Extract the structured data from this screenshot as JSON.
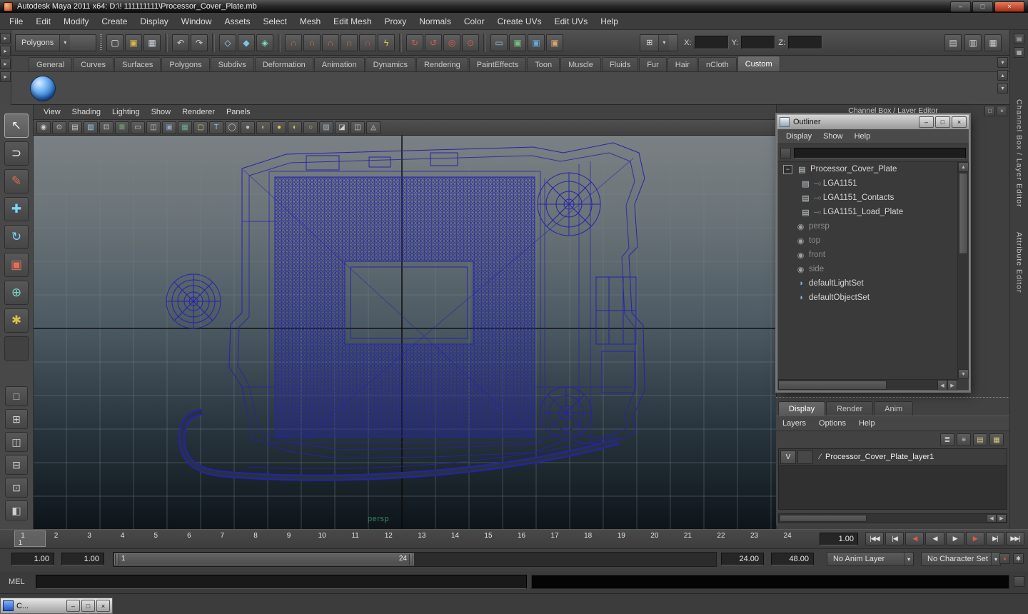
{
  "titlebar": {
    "title": "Autodesk Maya 2011 x64: D:\\! 111111111\\Processor_Cover_Plate.mb",
    "controls": [
      {
        "n": "minimize",
        "g": "–"
      },
      {
        "n": "maximize",
        "g": "□"
      },
      {
        "n": "close",
        "g": "×"
      }
    ]
  },
  "menubar": {
    "items": [
      "File",
      "Edit",
      "Modify",
      "Create",
      "Display",
      "Window",
      "Assets",
      "Select",
      "Mesh",
      "Edit Mesh",
      "Proxy",
      "Normals",
      "Color",
      "Create UVs",
      "Edit UVs",
      "Help"
    ]
  },
  "statusline": {
    "mode_selector": "Polygons",
    "x_label": "X:",
    "y_label": "Y:",
    "z_label": "Z:",
    "left_toggles": [
      {
        "n": "collapse-toolbar-row-1",
        "g": "▸"
      },
      {
        "n": "collapse-toolbar-row-2",
        "g": "▸"
      },
      {
        "n": "collapse-toolbar-row-3",
        "g": "▸"
      },
      {
        "n": "collapse-toolbar-row-4",
        "g": "▸"
      }
    ],
    "icons": [
      {
        "n": "new-scene",
        "g": "▢",
        "c": "#e4e4e4"
      },
      {
        "n": "open-scene",
        "g": "▣",
        "c": "#d9b649"
      },
      {
        "n": "save-scene",
        "g": "▦",
        "c": "#ccd4dc"
      },
      {
        "sep": true
      },
      {
        "n": "undo",
        "g": "↶",
        "c": "#cfcfcf"
      },
      {
        "n": "redo",
        "g": "↷",
        "c": "#cfcfcf"
      },
      {
        "sep": true
      },
      {
        "n": "select-by-hierarchy",
        "g": "◇",
        "c": "#9fd4ef"
      },
      {
        "n": "select-by-object-type",
        "g": "◆",
        "c": "#7cc5e8"
      },
      {
        "n": "select-by-component-type",
        "g": "◈",
        "c": "#7de0c2"
      },
      {
        "sep": true
      },
      {
        "n": "snap-to-grids",
        "g": "∩",
        "c": "#e0614d"
      },
      {
        "n": "snap-to-curves",
        "g": "∩",
        "c": "#d8744a"
      },
      {
        "n": "snap-to-points",
        "g": "∩",
        "c": "#e0614d"
      },
      {
        "n": "snap-to-view-planes",
        "g": "∩",
        "c": "#d8744a"
      },
      {
        "n": "snap-to-surfaces",
        "g": "∩",
        "c": "#c85a46"
      },
      {
        "n": "make-object-live",
        "g": "ϟ",
        "c": "#dcc84e"
      },
      {
        "sep": true
      },
      {
        "n": "inputs-to-selected-object",
        "g": "↻",
        "c": "#d85c4c"
      },
      {
        "n": "outputs-from-selected-object",
        "g": "↺",
        "c": "#d85c4c"
      },
      {
        "n": "construction-history-toggle",
        "g": "◎",
        "c": "#d85c4c"
      },
      {
        "n": "selection-highlighting",
        "g": "⊙",
        "c": "#d85c4c"
      },
      {
        "sep": true
      },
      {
        "n": "open-render-view",
        "g": "▭",
        "c": "#93bcd8"
      },
      {
        "n": "render-current-frame",
        "g": "▣",
        "c": "#74bd85"
      },
      {
        "n": "ipr-render",
        "g": "▣",
        "c": "#63a8d8"
      },
      {
        "n": "render-settings",
        "g": "▣",
        "c": "#d8a468"
      }
    ],
    "right_icons": [
      {
        "n": "show-channel-box",
        "g": "▤",
        "c": "#cfcfcf"
      },
      {
        "n": "show-layer-editor",
        "g": "▥",
        "c": "#cfcfcf"
      },
      {
        "n": "show-attribute-editor",
        "g": "▦",
        "c": "#cfcfcf"
      }
    ]
  },
  "shelf": {
    "tabs": [
      "General",
      "Curves",
      "Surfaces",
      "Polygons",
      "Subdivs",
      "Deformation",
      "Animation",
      "Dynamics",
      "Rendering",
      "PaintEffects",
      "Toon",
      "Muscle",
      "Fluids",
      "Fur",
      "Hair",
      "nCloth",
      "Custom"
    ],
    "active_tab": "Custom",
    "controls": [
      {
        "n": "shelf-menu",
        "g": "▾"
      },
      {
        "n": "shelf-scroll-up",
        "g": "▴"
      },
      {
        "n": "shelf-scroll-down",
        "g": "▾"
      }
    ]
  },
  "toolbox": {
    "tools": [
      {
        "n": "select-tool",
        "g": "↖",
        "c": "#ececec",
        "sel": true
      },
      {
        "n": "lasso-select-tool",
        "g": "⊃",
        "c": "#ececec"
      },
      {
        "n": "paint-selection-tool",
        "g": "✎",
        "c": "#e06a56"
      },
      {
        "n": "move-tool",
        "g": "✚",
        "c": "#7fd4ff"
      },
      {
        "n": "rotate-tool",
        "g": "↻",
        "c": "#7fd4ff"
      },
      {
        "n": "scale-tool",
        "g": "▣",
        "c": "#e0705a"
      },
      {
        "n": "universal-manipulator-tool",
        "g": "⊕",
        "c": "#7fd4c8"
      },
      {
        "n": "soft-modification-tool",
        "g": "✱",
        "c": "#d8c04a"
      },
      {
        "n": "last-tool-slot",
        "g": "",
        "c": "#888888"
      }
    ],
    "layouts": [
      {
        "n": "single-pane-layout",
        "g": "□"
      },
      {
        "n": "four-pane-layout",
        "g": "⊞"
      },
      {
        "n": "two-pane-side-by-side-layout",
        "g": "◫"
      },
      {
        "n": "two-pane-stacked-layout",
        "g": "⊟"
      },
      {
        "n": "three-pane-layout",
        "g": "⊡"
      },
      {
        "n": "outliner-persp-layout",
        "g": "◧"
      }
    ]
  },
  "viewport": {
    "menu": [
      "View",
      "Shading",
      "Lighting",
      "Show",
      "Renderer",
      "Panels"
    ],
    "camera_label": "persp"
  },
  "panel_toolbar": {
    "icons": [
      {
        "n": "select-camera",
        "g": "◉",
        "c": "#cfcfcf"
      },
      {
        "n": "camera-attributes",
        "g": "⊙",
        "c": "#cfcfcf"
      },
      {
        "n": "bookmarks",
        "g": "▤",
        "c": "#cfcfcf"
      },
      {
        "n": "image-plane",
        "g": "▧",
        "c": "#9fc9e8"
      },
      {
        "n": "two-d-pan-zoom",
        "g": "⊡",
        "c": "#cfcfcf"
      },
      {
        "n": "grid-toggle",
        "g": "⊞",
        "c": "#7fbf7f"
      },
      {
        "n": "film-gate",
        "g": "▭",
        "c": "#cfcfcf"
      },
      {
        "n": "resolution-gate",
        "g": "◫",
        "c": "#cfcfcf"
      },
      {
        "n": "gate-mask",
        "g": "▣",
        "c": "#8fa8c8"
      },
      {
        "n": "field-chart",
        "g": "▦",
        "c": "#6fae8f"
      },
      {
        "n": "safe-action",
        "g": "▢",
        "c": "#d8d86a"
      },
      {
        "n": "safe-title",
        "g": "T",
        "c": "#8fc9e8"
      },
      {
        "n": "wireframe-mode",
        "g": "◯",
        "c": "#bfbfbf"
      },
      {
        "n": "smooth-shade-mode",
        "g": "●",
        "c": "#bfbfbf"
      },
      {
        "n": "textured-mode",
        "g": "◐",
        "c": "#c8a06a"
      },
      {
        "n": "lighting-default",
        "g": "●",
        "c": "#e0c840"
      },
      {
        "n": "lighting-all",
        "g": "◐",
        "c": "#e0c840"
      },
      {
        "n": "lighting-none",
        "g": "○",
        "c": "#e0c840"
      },
      {
        "n": "xray-mode",
        "g": "▨",
        "c": "#9fb8c8"
      },
      {
        "n": "isolate-select",
        "g": "◪",
        "c": "#cfcfcf"
      },
      {
        "n": "viewport-renderer",
        "g": "◫",
        "c": "#cfcfcf"
      },
      {
        "n": "share-view",
        "g": "◬",
        "c": "#cfcfcf"
      }
    ]
  },
  "channel_header": {
    "title": "Channel Box / Layer Editor",
    "controls": [
      {
        "n": "pane-tear-off",
        "g": "□"
      },
      {
        "n": "pane-close",
        "g": "×"
      }
    ]
  },
  "outliner": {
    "title": "Outliner",
    "menu": [
      "Display",
      "Show",
      "Help"
    ],
    "window_controls": [
      {
        "n": "minimize",
        "g": "–"
      },
      {
        "n": "maximize",
        "g": "□"
      },
      {
        "n": "close",
        "g": "×"
      }
    ],
    "items": [
      {
        "label": "Processor_Cover_Plate",
        "type": "mesh",
        "depth": 0,
        "expanded": true
      },
      {
        "label": "LGA1151",
        "type": "mesh",
        "depth": 1
      },
      {
        "label": "LGA1151_Contacts",
        "type": "mesh",
        "depth": 1
      },
      {
        "label": "LGA1151_Load_Plate",
        "type": "mesh",
        "depth": 1
      },
      {
        "label": "persp",
        "type": "camera",
        "depth": 0,
        "muted": true
      },
      {
        "label": "top",
        "type": "camera",
        "depth": 0,
        "muted": true
      },
      {
        "label": "front",
        "type": "camera",
        "depth": 0,
        "muted": true
      },
      {
        "label": "side",
        "type": "camera",
        "depth": 0,
        "muted": true
      },
      {
        "label": "defaultLightSet",
        "type": "set",
        "depth": 0
      },
      {
        "label": "defaultObjectSet",
        "type": "set",
        "depth": 0
      }
    ]
  },
  "layer_editor": {
    "tabs": [
      "Display",
      "Render",
      "Anim"
    ],
    "active_tab": "Display",
    "menu": [
      "Layers",
      "Options",
      "Help"
    ],
    "icons": [
      {
        "n": "sort-layers",
        "g": "≣",
        "c": "#d0d0d0"
      },
      {
        "n": "layers-chronological",
        "g": "≡",
        "c": "#d0d0d0"
      },
      {
        "n": "create-empty-layer",
        "g": "▤",
        "c": "#d8c87a"
      },
      {
        "n": "create-layer-from-selected",
        "g": "▦",
        "c": "#d8c87a"
      }
    ],
    "layers": [
      {
        "visible": "V",
        "name": "Processor_Cover_Plate_layer1"
      }
    ]
  },
  "right_strip": {
    "icons": [
      {
        "n": "toggle-channel-box",
        "g": "▤"
      },
      {
        "n": "toggle-tool-settings",
        "g": "▦"
      }
    ],
    "labels": [
      "Channel Box / Layer Editor",
      "Attribute Editor"
    ]
  },
  "timeline": {
    "ticks": [
      "1",
      "2",
      "3",
      "4",
      "5",
      "6",
      "7",
      "8",
      "9",
      "10",
      "11",
      "12",
      "13",
      "14",
      "15",
      "16",
      "17",
      "18",
      "19",
      "20",
      "21",
      "22",
      "23",
      "24"
    ],
    "current_frame": "1",
    "current_time": "1.00",
    "transport": [
      {
        "n": "go-to-start",
        "g": "|◀◀"
      },
      {
        "n": "step-back-frame",
        "g": "|◀"
      },
      {
        "n": "step-back-key",
        "g": "◀",
        "key": true
      },
      {
        "n": "play-backwards",
        "g": "◀"
      },
      {
        "n": "play-forwards",
        "g": "▶"
      },
      {
        "n": "step-forward-key",
        "g": "▶",
        "key": true
      },
      {
        "n": "step-forward-frame",
        "g": "▶|"
      },
      {
        "n": "go-to-end",
        "g": "▶▶|"
      }
    ]
  },
  "range_slider": {
    "anim_start": "1.00",
    "playback_start": "1.00",
    "range_start_label": "1",
    "range_end_label": "24",
    "playback_end": "24.00",
    "anim_end": "48.00",
    "anim_layer": "No Anim Layer",
    "character_set": "No Character Set",
    "icons": [
      {
        "n": "auto-keyframe-toggle",
        "g": "●",
        "c": "#c85048"
      },
      {
        "n": "animation-preferences",
        "g": "✱",
        "c": "#cfcfcf"
      }
    ]
  },
  "command_line": {
    "label": "MEL"
  },
  "taskbar_window": {
    "title": "C...",
    "controls": [
      {
        "n": "minimize",
        "g": "–"
      },
      {
        "n": "restore",
        "g": "□"
      },
      {
        "n": "close",
        "g": "×"
      }
    ]
  },
  "glyphs": {
    "caret": "▾",
    "up": "▴",
    "down": "▾",
    "sup": "▲",
    "sdown": "▼",
    "sleft": "◀",
    "sright": "▶",
    "collapse": "−",
    "dash-circle": "─○",
    "diag": "∕",
    "mask": "⊞"
  },
  "colors": {
    "wireframe": "#2424a8",
    "axis": "#0a0a0a",
    "persp_label": "#3f8360"
  }
}
